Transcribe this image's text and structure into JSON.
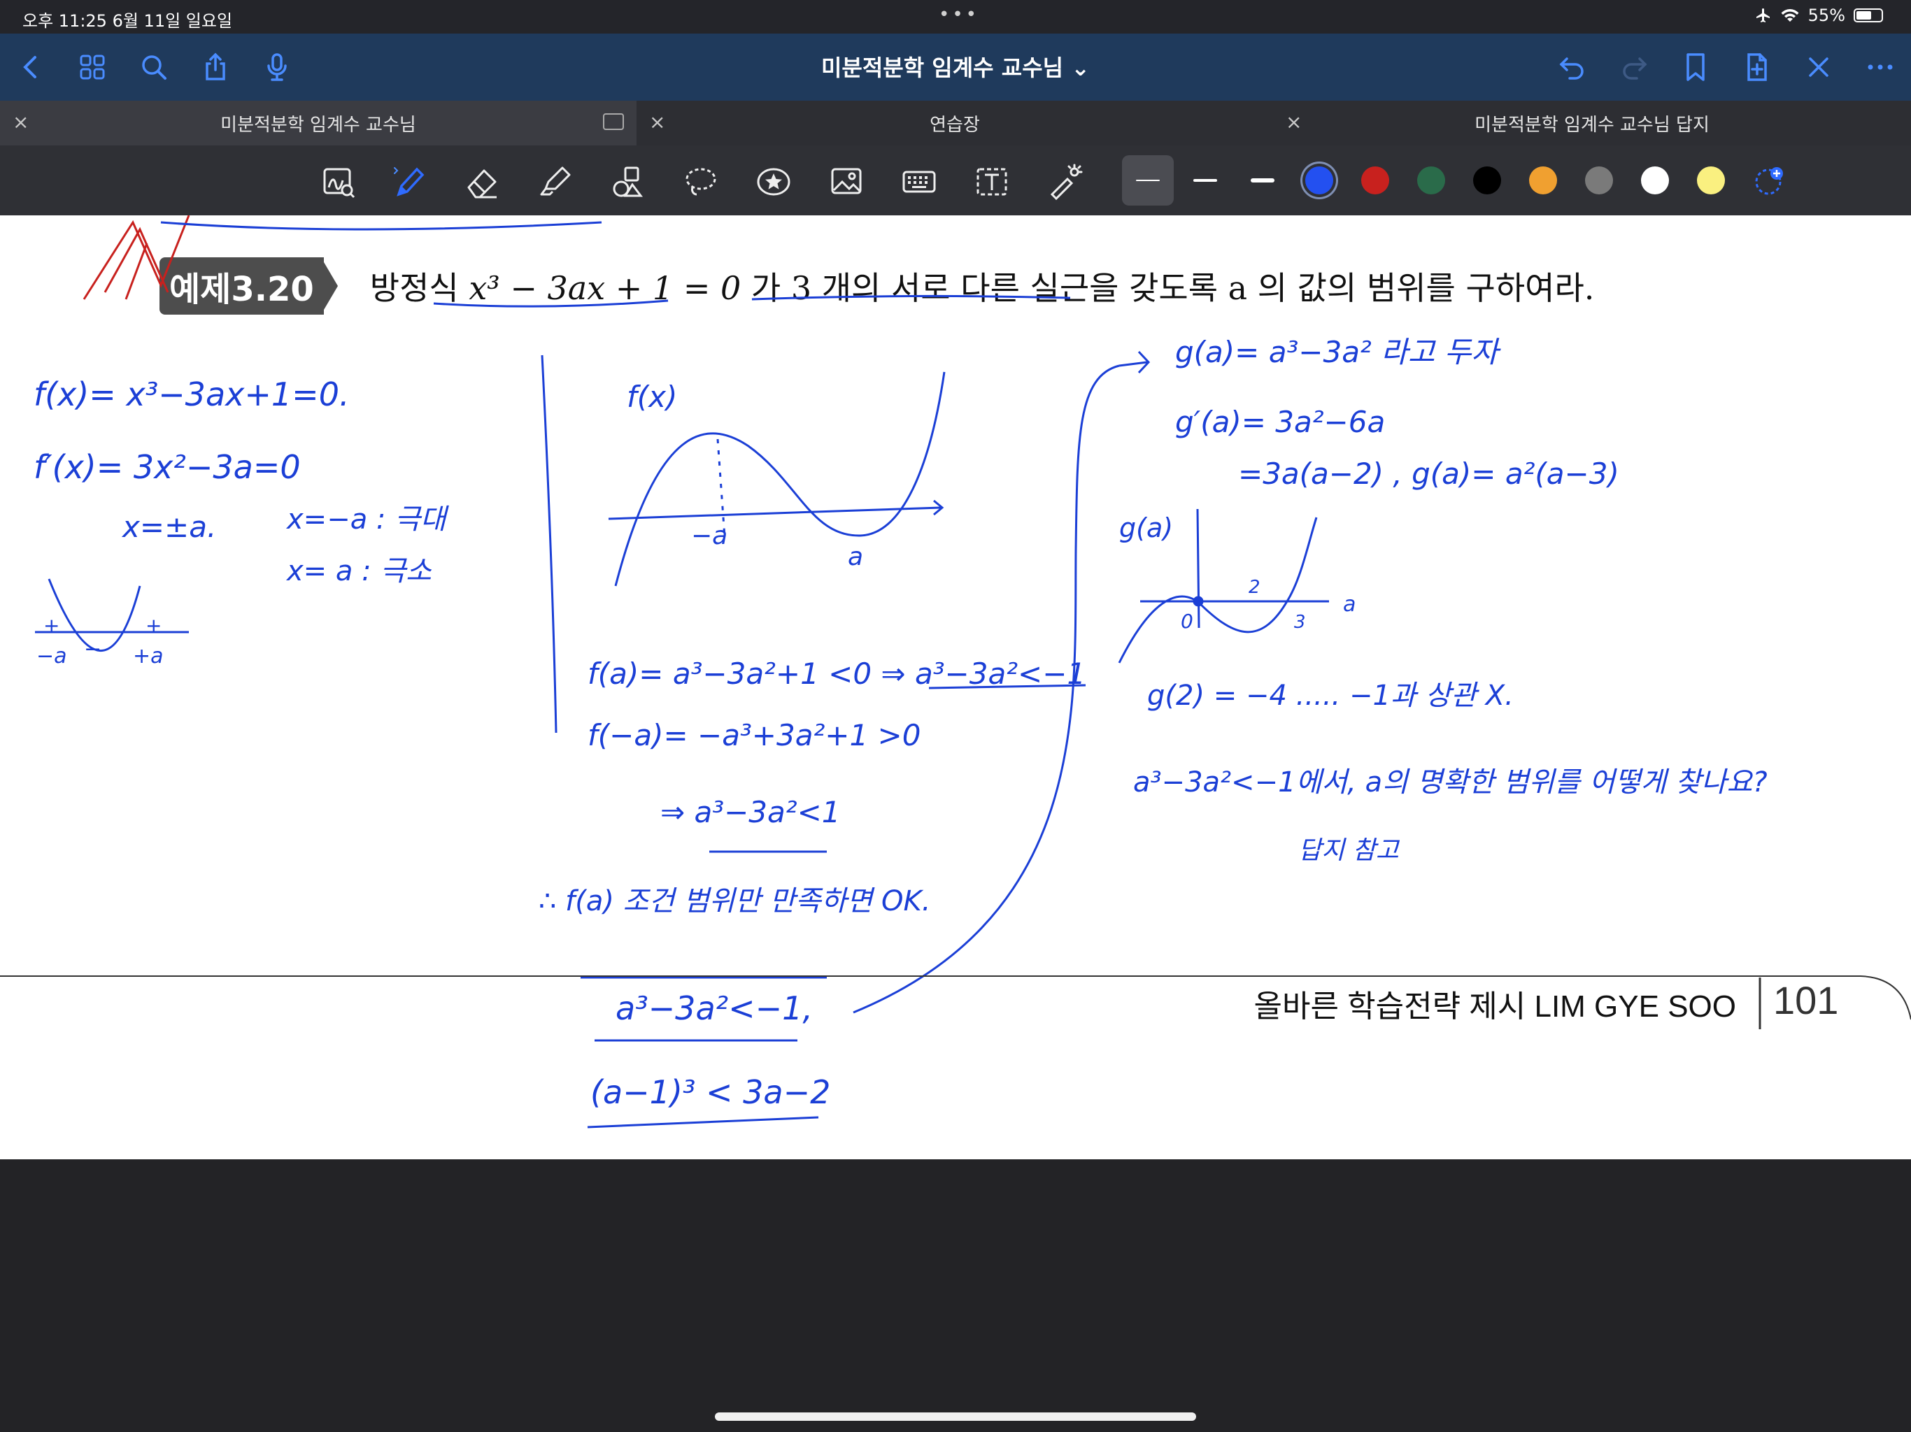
{
  "status_bar": {
    "time": "오후 11:25   6월 11일 일요일",
    "dots": "•••",
    "battery": "55%",
    "battery_level": 0.55
  },
  "nav": {
    "title": "미분적분학 임계수 교수님 ⌄"
  },
  "tabs": [
    {
      "label": "미분적분학 임계수 교수님",
      "close": "×"
    },
    {
      "label": "연습장",
      "close": "×"
    },
    {
      "label": "미분적분학 임계수 교수님 답지",
      "close": "×"
    }
  ],
  "colors": {
    "accent": "#4a8cff",
    "ink_blue": "#1b3fd6",
    "ink_red": "#c8211e",
    "swatches": [
      "#2350f0",
      "#c8211e",
      "#2a6b4a",
      "#000000",
      "#f0a030",
      "#7a7a7a",
      "#ffffff",
      "#faf080"
    ]
  },
  "page": {
    "badge": "예제3.20",
    "problem_prefix": "방정식 ",
    "problem_math": "x³ − 3ax + 1 = 0",
    "problem_suffix": " 가 3 개의 서로 다른 실근을 갖도록 a 의 값의 범위를 구하여라.",
    "footer": "올바른 학습전략 제시 LIM GYE SOO",
    "page_number": "101"
  },
  "handwriting": {
    "l1": "f(x)= x³−3ax+1=0.",
    "l2": "f′(x)= 3x²−3a=0",
    "l3": "x=±a.",
    "l4": "x=−a : 극대",
    "l5": "x= a : 극소",
    "g_neg_a": "−a",
    "g_plus_a": "+a",
    "g_minus": "−",
    "g_plus": "+",
    "fx_label": "f(x)",
    "neg_a": "−a",
    "pos_a": "a",
    "m1": "f(a)= a³−3a²+1 <0  ⇒  a³−3a²<−1",
    "m2": "f(−a)= −a³+3a²+1 >0",
    "m3": "⇒  a³−3a²<1",
    "m4": "∴ f(a) 조건 범위만 만족하면 OK.",
    "b1": "a³−3a²<−1,",
    "b2": "(a−1)³ < 3a−2",
    "r1": "g(a)= a³−3a² 라고 두자",
    "r2": "g′(a)= 3a²−6a",
    "r3": "=3a(a−2) ,  g(a)= a²(a−3)",
    "ga_label": "g(a)",
    "zero": "0",
    "two": "2",
    "three": "3",
    "a_axis": "a",
    "r4": "g(2) = −4 ..... −1과 상관 X.",
    "r5": "a³−3a²<−1에서, a의 명확한 범위를 어떻게 찾나요?",
    "r6": "답지 참고"
  }
}
